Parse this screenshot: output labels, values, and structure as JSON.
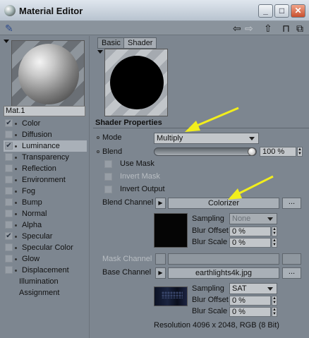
{
  "window": {
    "title": "Material Editor",
    "buttons": [
      "_",
      "□",
      "✕"
    ]
  },
  "toolbar": {
    "icons": [
      "pin-icon",
      "back-arrow-icon",
      "forward-arrow-icon",
      "up-arrow-icon",
      "lock-icon",
      "new-window-icon"
    ]
  },
  "material": {
    "name": "Mat.1"
  },
  "channels": [
    {
      "label": "Color",
      "checked": true
    },
    {
      "label": "Diffusion",
      "checked": false
    },
    {
      "label": "Luminance",
      "checked": true,
      "selected": true
    },
    {
      "label": "Transparency",
      "checked": false
    },
    {
      "label": "Reflection",
      "checked": false
    },
    {
      "label": "Environment",
      "checked": false
    },
    {
      "label": "Fog",
      "checked": false
    },
    {
      "label": "Bump",
      "checked": false
    },
    {
      "label": "Normal",
      "checked": false
    },
    {
      "label": "Alpha",
      "checked": false
    },
    {
      "label": "Specular",
      "checked": true
    },
    {
      "label": "Specular Color",
      "checked": false
    },
    {
      "label": "Glow",
      "checked": false
    },
    {
      "label": "Displacement",
      "checked": false
    },
    {
      "label": "Illumination",
      "noflag": true
    },
    {
      "label": "Assignment",
      "noflag": true
    }
  ],
  "tabs": [
    "Basic",
    "Shader"
  ],
  "shader": {
    "section_title": "Shader Properties",
    "mode_label": "Mode",
    "mode_value": "Multiply",
    "blend_label": "Blend",
    "blend_value": "100 %",
    "blend_fraction": 1.0,
    "use_mask": "Use Mask",
    "invert_mask": "Invert Mask",
    "invert_output": "Invert Output",
    "blend_channel_label": "Blend Channel",
    "blend_channel_value": "Colorizer",
    "more_button": "...",
    "blend_sampling_label": "Sampling",
    "blend_sampling_value": "None",
    "blur_offset_label": "Blur Offset",
    "blur_offset_value": "0 %",
    "blur_scale_label": "Blur Scale",
    "blur_scale_value": "0 %",
    "mask_channel_label": "Mask Channel",
    "base_channel_label": "Base Channel",
    "base_channel_value": "earthlights4k.jpg",
    "base_sampling_label": "Sampling",
    "base_sampling_value": "SAT",
    "base_blur_offset_value": "0 %",
    "base_blur_scale_value": "0 %",
    "resolution": "Resolution 4096 x 2048, RGB (8 Bit)"
  },
  "colors": {
    "panel_bg": "#7d8690",
    "annotation_arrow": "#f2ee1c"
  }
}
